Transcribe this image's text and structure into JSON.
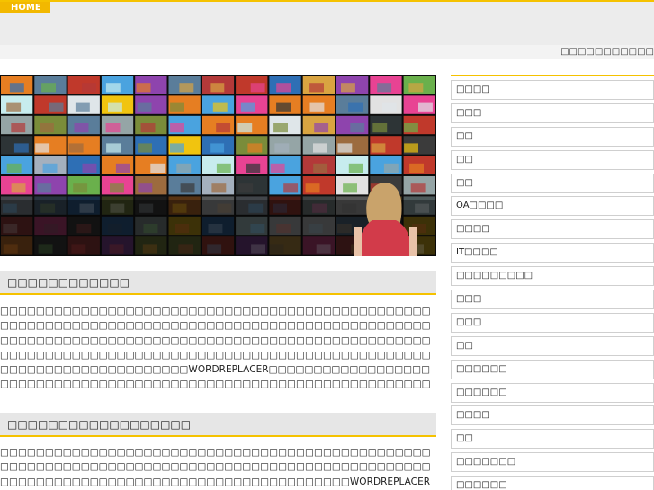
{
  "header": {
    "home_label": "HOME",
    "site_title": "□□□□□□□□□□□"
  },
  "hero": {
    "description": "video wall of photo thumbnails with a woman in red dress"
  },
  "colors": {
    "accent": "#f5c200",
    "header_bg": "#ececec",
    "section_bg": "#e6e6e6"
  },
  "sections": [
    {
      "title": "□□□□□□□□□□□□",
      "body": "□□□□□□□□□□□□□□□□□□□□□□□□□□□□□□□□□□□□□□□□□□□□□□□□□□□□□□□□□□□□□□□□□□□□□□□□□□□□□□□□□□□□□□□□□□□□□□□□□□□□□□□□□□□□□□□□□□□□□□□□□□□□□□□□□□□□□□□□□□□□□□□□□□□□□□□□□□□□□□□□□□□□□□□□□□□□□□□□□□□□□□□□□□□□□□□□□□□□□□□□□□□□□□□□□□□□□WORDREPLACER□□□□□□□□□□□□□□□□□□□□□□□□□□□□□□□□□□□□□□□□□□□□□□□□□□□□□□□□□□□□□□□□□□□□□□□□□□□□□□□□□□□□□□□□□□□□□□□□□□□□□□□□"
    },
    {
      "title": "□□□□□□□□□□□□□□□□□□",
      "body": "□□□□□□□□□□□□□□□□□□□□□□□□□□□□□□□□□□□□□□□□□□□□□□□□□□□□□□□□□□□□□□□□□□□□□□□□□□□□□□□□□□□□□□□□□□□□□□□□□□□□□□□□□□□□□□□□□□□□□□□□□□□□□□□□□□□□□□□WORDREPLACER□□□□□□□□□□□□□□□□□□□□□□□□□□□□□□□□□□□□□□□□□□□□□□□□□□□□"
    }
  ],
  "sidebar": {
    "items": [
      {
        "label": "□□□□"
      },
      {
        "label": "□□□"
      },
      {
        "label": "□□"
      },
      {
        "label": "□□"
      },
      {
        "label": "□□"
      },
      {
        "label": "OA□□□□"
      },
      {
        "label": "□□□□"
      },
      {
        "label": "IT□□□□"
      },
      {
        "label": "□□□□□□□□□"
      },
      {
        "label": "□□□"
      },
      {
        "label": "□□□"
      },
      {
        "label": "□□"
      },
      {
        "label": "□□□□□□"
      },
      {
        "label": "□□□□□□"
      },
      {
        "label": "□□□□"
      },
      {
        "label": "□□"
      },
      {
        "label": "□□□□□□□"
      },
      {
        "label": "□□□□□□"
      }
    ]
  }
}
